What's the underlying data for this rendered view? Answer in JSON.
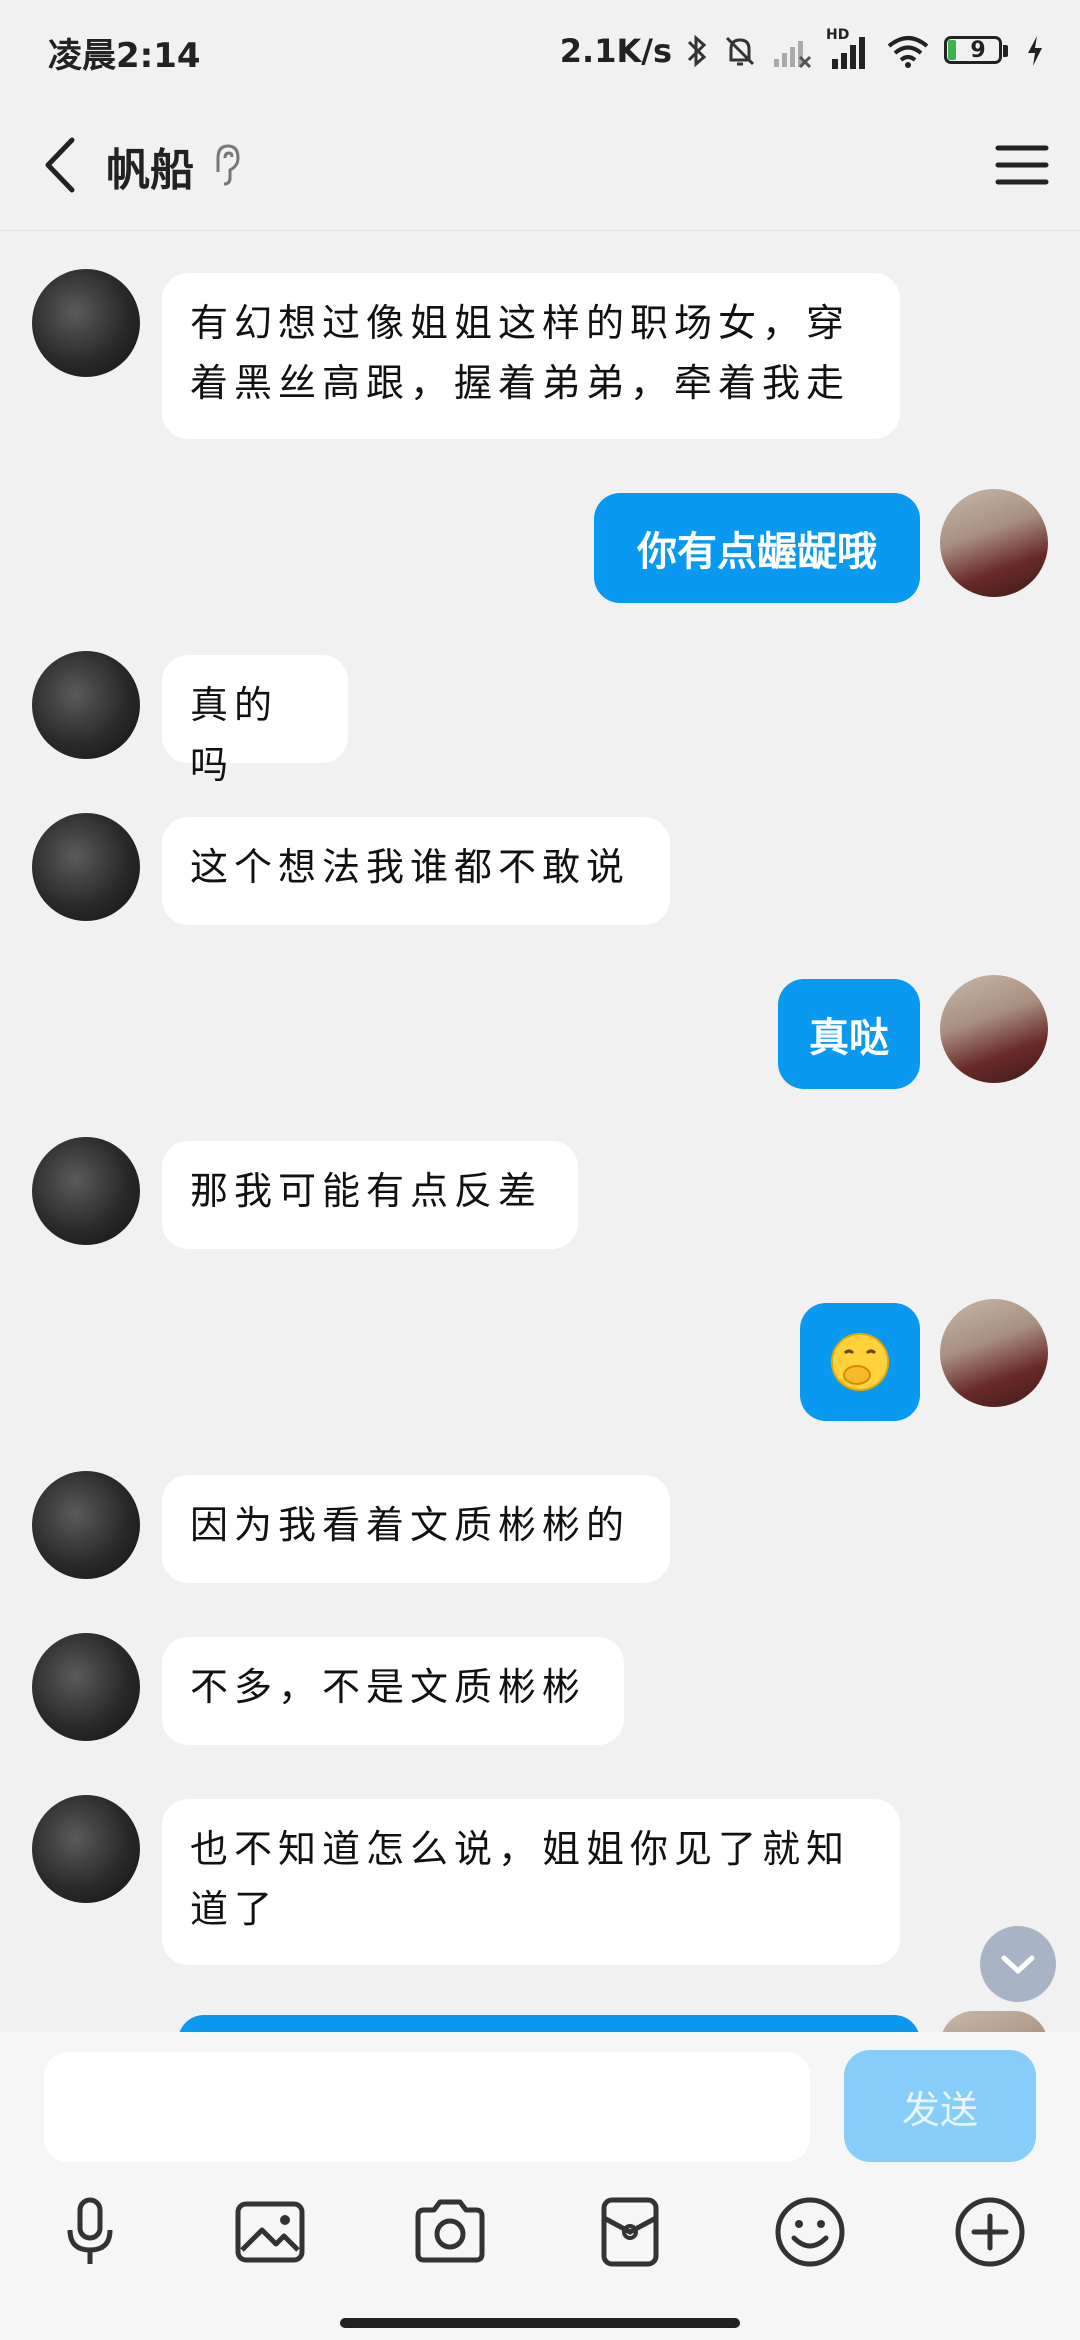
{
  "status_bar": {
    "time": "凌晨2:14",
    "net_speed": "2.1K/s",
    "network_badge": "HD",
    "battery": "9"
  },
  "header": {
    "title": "帆船"
  },
  "messages": [
    {
      "side": "in",
      "text": "有幻想过像姐姐这样的职场女，穿着黑丝高跟，握着弟弟，牵着我走"
    },
    {
      "side": "out",
      "text": "你有点龌龊哦"
    },
    {
      "side": "in",
      "text": "真的吗"
    },
    {
      "side": "in",
      "text": "这个想法我谁都不敢说"
    },
    {
      "side": "out",
      "text": "真哒"
    },
    {
      "side": "in",
      "text": "那我可能有点反差"
    },
    {
      "side": "out",
      "emoji": "face-with-hand-over-mouth"
    },
    {
      "side": "in",
      "text": "因为我看着文质彬彬的"
    },
    {
      "side": "in",
      "text": "不多，不是文质彬彬"
    },
    {
      "side": "in",
      "text": "也不知道怎么说，姐姐你见了就知道了"
    }
  ],
  "input": {
    "value": "",
    "send_label": "发送"
  },
  "toolbar": {
    "items": [
      "microphone-icon",
      "image-icon",
      "camera-icon",
      "red-packet-icon",
      "smiley-icon",
      "plus-icon"
    ]
  },
  "colors": {
    "outgoing_bubble": "#0a99f1",
    "incoming_bubble": "#ffffff",
    "background": "#f1f1f1",
    "send_button_disabled": "#87cdf9"
  }
}
